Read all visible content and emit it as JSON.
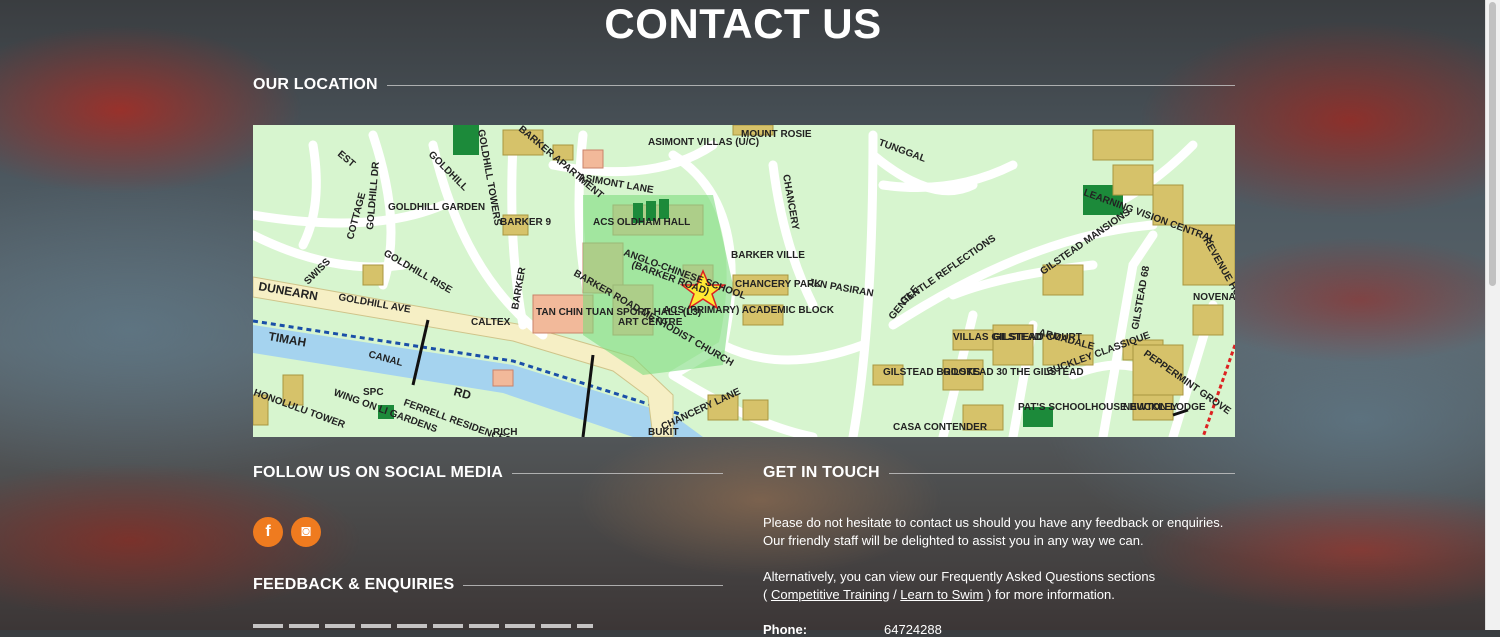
{
  "page": {
    "title": "CONTACT US"
  },
  "sections": {
    "location": "OUR LOCATION",
    "social": "FOLLOW US ON SOCIAL MEDIA",
    "feedback": "FEEDBACK & ENQUIRIES",
    "get_in_touch": "GET IN TOUCH"
  },
  "social_buttons": {
    "facebook": "f",
    "instagram": "◙"
  },
  "contact": {
    "para1_line1": "Please do not hesitate to contact us should you have any feedback or enquiries.",
    "para1_line2": "Our friendly staff will be delighted to assist you in any way we can.",
    "para2_line1": "Alternatively, you can view our Frequently Asked Questions sections",
    "para2_open": "( ",
    "link_competitive": "Competitive Training",
    "sep": " / ",
    "link_learn": "Learn to Swim",
    "para2_close": " ) for more information.",
    "phone_label": "Phone:",
    "phone_value": "64724288"
  },
  "map": {
    "labels": {
      "est": "EST",
      "cottage": "COTTAGE",
      "goldhill_dr": "GOLDHILL DR",
      "goldhill_garden": "GOLDHILL GARDEN",
      "goldhill": "GOLDHILL",
      "goldhill_towers": "GOLDHILL TOWERS",
      "barker_apartment": "BARKER APARTMENT",
      "asimont_villas": "ASIMONT VILLAS (U/C)",
      "mount_rosie": "MOUNT ROSIE",
      "asimont_lane": "ASIMONT LANE",
      "barker9": "BARKER 9",
      "acs_oldham_hall": "ACS OLDHAM HALL",
      "anglo_chinese": "ANGLO-CHINESE SCHOOL",
      "barker_road_bracket": "(BARKER ROAD)",
      "barker_road_methodist": "BARKER ROAD METHODIST CHURCH",
      "swiss": "SWISS",
      "goldhill_rise": "GOLDHILL RISE",
      "dunearn": "DUNEARN",
      "goldhill_ave": "GOLDHILL AVE",
      "timah": "TIMAH",
      "canal": "CANAL",
      "rd": "RD",
      "barker": "BARKER",
      "caltex": "CALTEX",
      "tan_chin_tuan": "TAN CHIN TUAN SPORT HALL (L3)",
      "art_centre": "ART CENTRE",
      "acs_primary": "ACS (PRIMARY) ACADEMIC BLOCK",
      "barker_ville": "BARKER VILLE",
      "chancery_park": "CHANCERY PARK",
      "jln_pasiran": "JLN PASIRAN",
      "chancery": "CHANCERY",
      "tunggal": "TUNGGAL",
      "gentle": "GENTLE",
      "gentle_reflections": "GENTLE REFLECTIONS",
      "gilstead_mansions": "GILSTEAD MANSIONS",
      "learning_vision": "LEARNING VISION CENTRAL",
      "revenue_house": "REVENUE HOUSE",
      "novena_po": "NOVENA P.O.",
      "gilstead_brooks": "GILSTEAD BROOKS",
      "gilstead30": "GILSTEAD 30 THE GILSTEAD",
      "villas_gilstead": "VILLAS GILSTEAD",
      "gilstead_court": "GILSTEAD COURT",
      "armadale": "ARMADALE",
      "buckley_classique": "BUCKLEY CLASSIQUE",
      "peppermint_grove": "PEPPERMINT GROVE",
      "newton_lodge": "NEWTON LODGE",
      "pats_schoolhouse": "PAT'S SCHOOLHOUSE BUCKLEY",
      "casa": "CASA CONTENDER",
      "chancery_lane": "CHANCERY LANE",
      "ferrell": "FERRELL RESIDENCES",
      "wing_on": "WING ON LI GARDENS",
      "honolulu_tower": "HONOLULU TOWER",
      "spc": "SPC",
      "gilstead_68": "GILSTEAD 68",
      "bukit": "BUKIT",
      "rich": "RICH"
    }
  }
}
